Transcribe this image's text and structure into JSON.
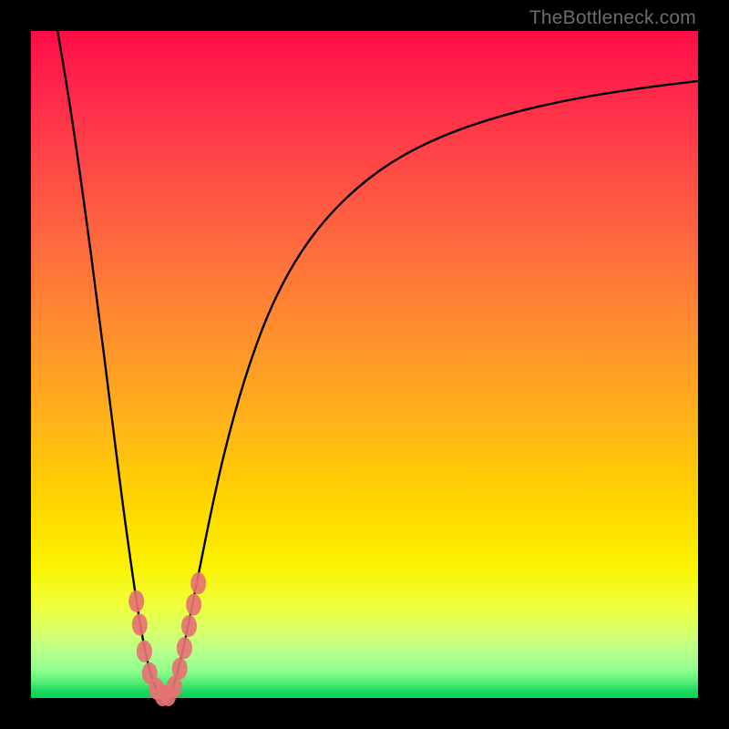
{
  "watermark": "TheBottleneck.com",
  "chart_data": {
    "type": "line",
    "title": "",
    "xlabel": "",
    "ylabel": "",
    "xlim": [
      0,
      100
    ],
    "ylim": [
      0,
      100
    ],
    "series": [
      {
        "name": "curve",
        "x": [
          4,
          6,
          8,
          10,
          12,
          13.5,
          15,
          16.5,
          18,
          19.5,
          20.5,
          21.5,
          23,
          25,
          27,
          29,
          32,
          36,
          41,
          47,
          54,
          62,
          71,
          81,
          91,
          100
        ],
        "y": [
          100,
          88,
          74,
          59,
          43,
          31,
          20,
          10,
          3,
          0,
          0,
          2,
          8,
          18,
          28,
          37,
          48,
          59,
          68,
          75,
          80.5,
          84.5,
          87.5,
          89.8,
          91.4,
          92.5
        ]
      }
    ],
    "markers": {
      "name": "highlight-dots",
      "color": "#e57373",
      "points": [
        {
          "x": 15.8,
          "y": 14.5
        },
        {
          "x": 16.3,
          "y": 11.0
        },
        {
          "x": 17.0,
          "y": 7.0
        },
        {
          "x": 17.8,
          "y": 3.7
        },
        {
          "x": 18.8,
          "y": 1.4
        },
        {
          "x": 19.7,
          "y": 0.4
        },
        {
          "x": 20.6,
          "y": 0.4
        },
        {
          "x": 21.5,
          "y": 1.7
        },
        {
          "x": 22.3,
          "y": 4.4
        },
        {
          "x": 23.0,
          "y": 7.5
        },
        {
          "x": 23.7,
          "y": 10.8
        },
        {
          "x": 24.4,
          "y": 14.0
        },
        {
          "x": 25.1,
          "y": 17.2
        }
      ]
    }
  }
}
